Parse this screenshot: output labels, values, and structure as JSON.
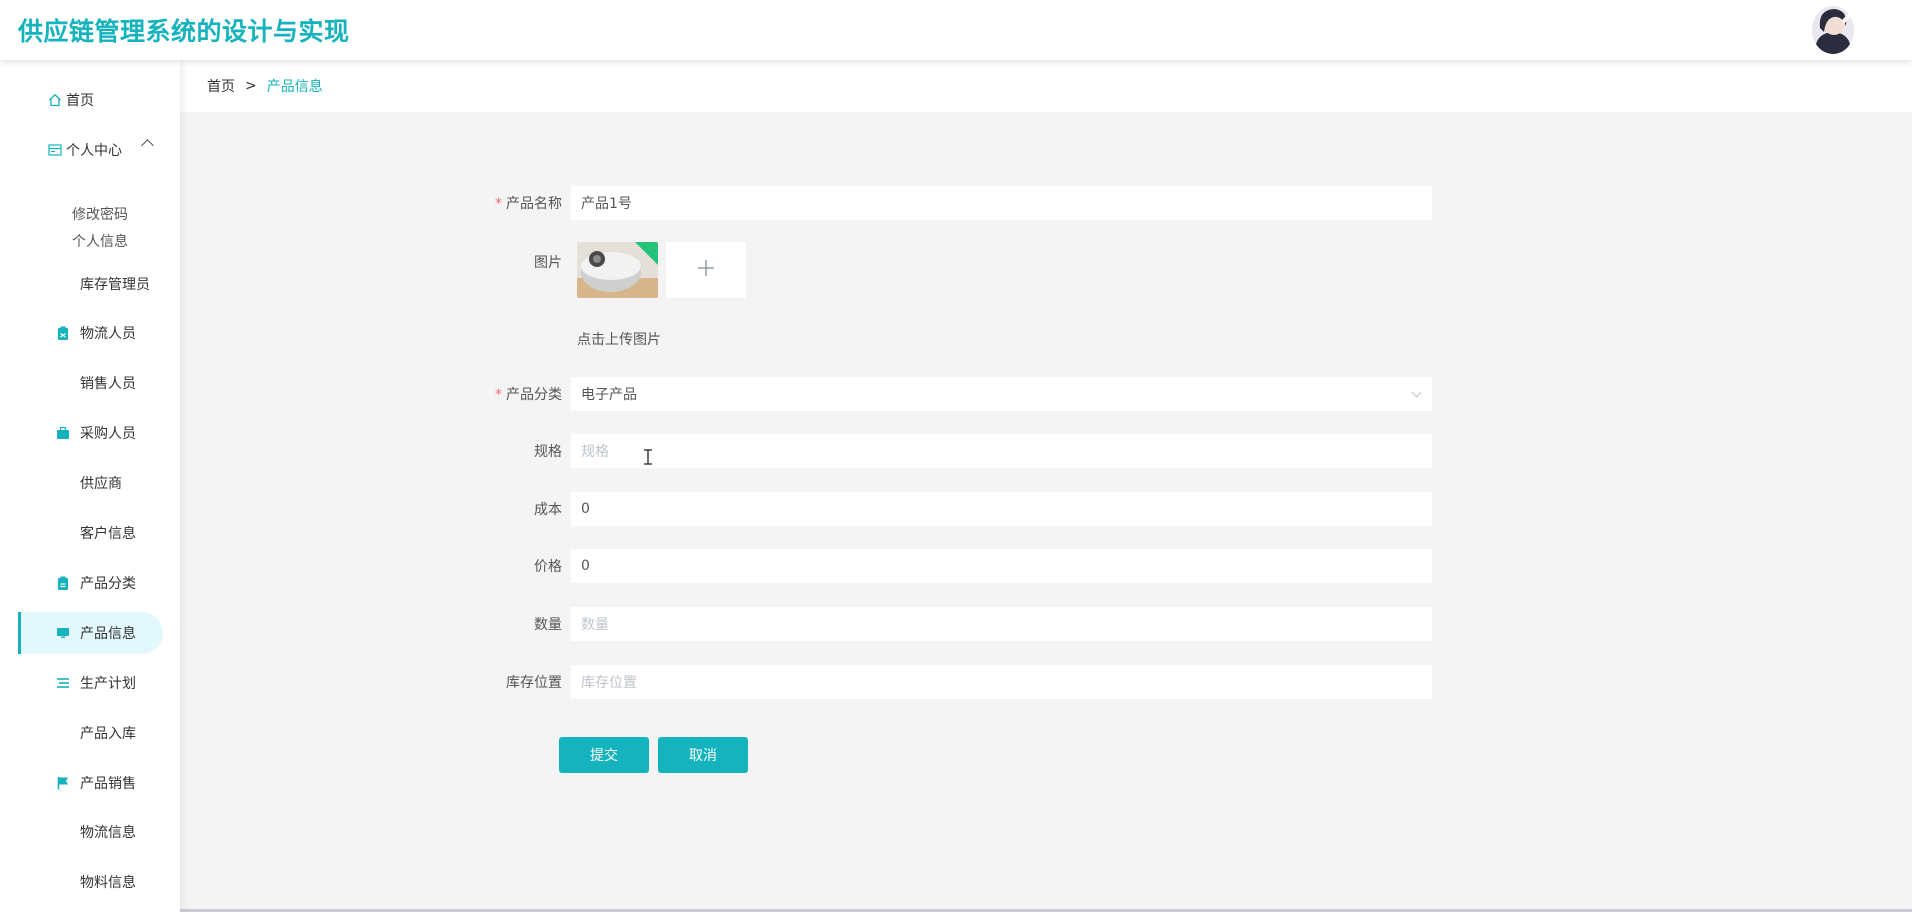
{
  "header": {
    "title": "供应链管理系统的设计与实现"
  },
  "colors": {
    "accent": "#14b3bd",
    "required_star": "#f56c6c",
    "background": "#f4f4f5"
  },
  "sidebar": {
    "home": {
      "label": "首页",
      "icon": "home-icon"
    },
    "personal_center": {
      "label": "个人中心",
      "icon": "card-icon",
      "children": [
        "修改密码",
        "个人信息"
      ]
    },
    "items": [
      {
        "label": "库存管理员",
        "icon": "grid-icon"
      },
      {
        "label": "物流人员",
        "icon": "clipboard-icon"
      },
      {
        "label": "销售人员",
        "icon": "grid-icon"
      },
      {
        "label": "采购人员",
        "icon": "briefcase-icon"
      },
      {
        "label": "供应商",
        "icon": "grid-icon"
      },
      {
        "label": "客户信息",
        "icon": "grid-icon"
      },
      {
        "label": "产品分类",
        "icon": "clipboard-icon"
      },
      {
        "label": "产品信息",
        "icon": "monitor-icon",
        "active": true
      },
      {
        "label": "生产计划",
        "icon": "list-icon"
      },
      {
        "label": "产品入库",
        "icon": "grid-icon"
      },
      {
        "label": "产品销售",
        "icon": "flag-icon"
      },
      {
        "label": "物流信息",
        "icon": "grid-icon"
      },
      {
        "label": "物料信息",
        "icon": "grid-icon"
      }
    ]
  },
  "breadcrumb": {
    "home": "首页",
    "separator": ">",
    "current": "产品信息"
  },
  "form": {
    "product_name": {
      "label": "产品名称",
      "required": "*",
      "value": "产品1号"
    },
    "image": {
      "label": "图片",
      "hint": "点击上传图片",
      "add_icon": "plus-icon"
    },
    "category": {
      "label": "产品分类",
      "required": "*",
      "value": "电子产品"
    },
    "spec": {
      "label": "规格",
      "placeholder": "规格"
    },
    "cost": {
      "label": "成本",
      "value": "0"
    },
    "price": {
      "label": "价格",
      "value": "0"
    },
    "quantity": {
      "label": "数量",
      "placeholder": "数量"
    },
    "location": {
      "label": "库存位置",
      "placeholder": "库存位置"
    },
    "submit_label": "提交",
    "cancel_label": "取消"
  }
}
